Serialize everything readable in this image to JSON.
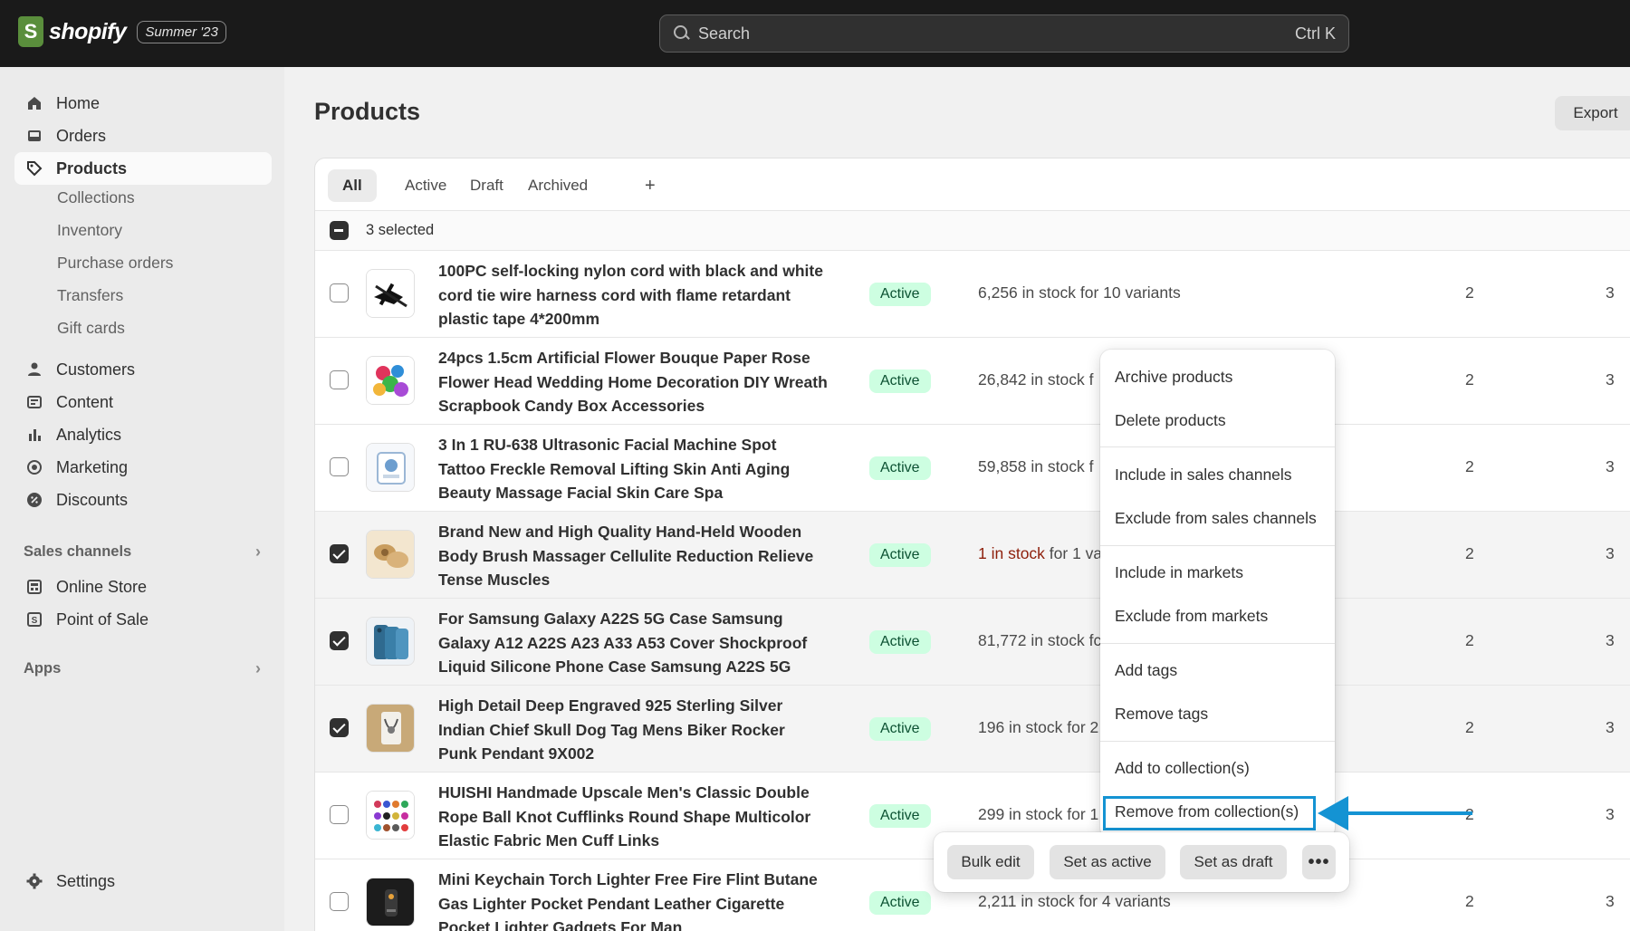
{
  "brand": {
    "name": "shopify",
    "badge": "Summer '23",
    "logo_letter": "S"
  },
  "search": {
    "placeholder": "Search",
    "shortcut": "Ctrl K"
  },
  "sidebar": {
    "main": [
      {
        "label": "Home",
        "icon": "home-icon"
      },
      {
        "label": "Orders",
        "icon": "orders-icon"
      },
      {
        "label": "Products",
        "icon": "tag-icon"
      }
    ],
    "product_sub": [
      "Collections",
      "Inventory",
      "Purchase orders",
      "Transfers",
      "Gift cards"
    ],
    "more": [
      {
        "label": "Customers",
        "icon": "person-icon"
      },
      {
        "label": "Content",
        "icon": "content-icon"
      },
      {
        "label": "Analytics",
        "icon": "bar-chart-icon"
      },
      {
        "label": "Marketing",
        "icon": "target-icon"
      },
      {
        "label": "Discounts",
        "icon": "discount-icon"
      }
    ],
    "sales_channels_label": "Sales channels",
    "channels": [
      {
        "label": "Online Store",
        "icon": "store-icon"
      },
      {
        "label": "Point of Sale",
        "icon": "pos-icon"
      }
    ],
    "apps_label": "Apps",
    "settings_label": "Settings"
  },
  "page": {
    "title": "Products",
    "export_label": "Export"
  },
  "tabs": [
    "All",
    "Active",
    "Draft",
    "Archived",
    "+"
  ],
  "bulk": {
    "selected_label": "3 selected"
  },
  "products": [
    {
      "name": "100PC self-locking nylon cord with black and white cord tie wire harness cord with flame retardant plastic tape 4*200mm",
      "status": "Active",
      "inv_low": "",
      "inv": "6,256 in stock for 10 variants",
      "n1": "2",
      "n2": "3",
      "checked": false
    },
    {
      "name": "24pcs 1.5cm Artificial Flower Bouque Paper Rose Flower Head Wedding Home Decoration DIY Wreath Scrapbook Candy Box Accessories",
      "status": "Active",
      "inv_low": "",
      "inv": "26,842 in stock f",
      "n1": "2",
      "n2": "3",
      "checked": false
    },
    {
      "name": "3 In 1 RU-638 Ultrasonic Facial Machine Spot Tattoo Freckle Removal Lifting Skin Anti Aging Beauty Massage Facial Skin Care Spa",
      "status": "Active",
      "inv_low": "",
      "inv": "59,858 in stock f",
      "n1": "2",
      "n2": "3",
      "checked": false
    },
    {
      "name": "Brand New and High Quality Hand-Held Wooden Body Brush Massager Cellulite Reduction Relieve Tense Muscles",
      "status": "Active",
      "inv_low": "1 in stock",
      "inv": " for 1 va",
      "n1": "2",
      "n2": "3",
      "checked": true
    },
    {
      "name": "For Samsung Galaxy A22S 5G Case Samsung Galaxy A12 A22S A23 A33 A53 Cover Shockproof Liquid Silicone Phone Case Samsung A22S 5G",
      "status": "Active",
      "inv_low": "",
      "inv": "81,772 in stock fc",
      "n1": "2",
      "n2": "3",
      "checked": true
    },
    {
      "name": "High Detail Deep Engraved 925 Sterling Silver Indian Chief Skull Dog Tag Mens Biker Rocker Punk Pendant 9X002",
      "status": "Active",
      "inv_low": "",
      "inv": "196 in stock for 2",
      "n1": "2",
      "n2": "3",
      "checked": true
    },
    {
      "name": "HUISHI Handmade Upscale Men's Classic Double Rope Ball Knot Cufflinks Round Shape Multicolor Elastic Fabric Men Cuff Links",
      "status": "Active",
      "inv_low": "",
      "inv": "299 in stock for 1",
      "n1": "2",
      "n2": "3",
      "checked": false
    },
    {
      "name": "Mini Keychain Torch Lighter Free Fire Flint Butane Gas Lighter Pocket Pendant Leather Cigarette Pocket Lighter Gadgets For Man",
      "status": "Active",
      "inv_low": "",
      "inv": "2,211 in stock for 4 variants",
      "n1": "2",
      "n2": "3",
      "checked": false
    }
  ],
  "menu": {
    "archive": "Archive products",
    "delete": "Delete products",
    "include_channels": "Include in sales channels",
    "exclude_channels": "Exclude from sales channels",
    "include_markets": "Include in markets",
    "exclude_markets": "Exclude from markets",
    "add_tags": "Add tags",
    "remove_tags": "Remove tags",
    "add_collection": "Add to collection(s)",
    "remove_collection": "Remove from collection(s)"
  },
  "actionbar": {
    "bulk_edit": "Bulk edit",
    "set_active": "Set as active",
    "set_draft": "Set as draft",
    "more": "•••"
  },
  "colors": {
    "highlight": "#1493d3",
    "status_bg": "#cdfee1",
    "status_text": "#0c5132",
    "low_stock": "#8e1f0b",
    "topbar": "#1a1a1a"
  }
}
